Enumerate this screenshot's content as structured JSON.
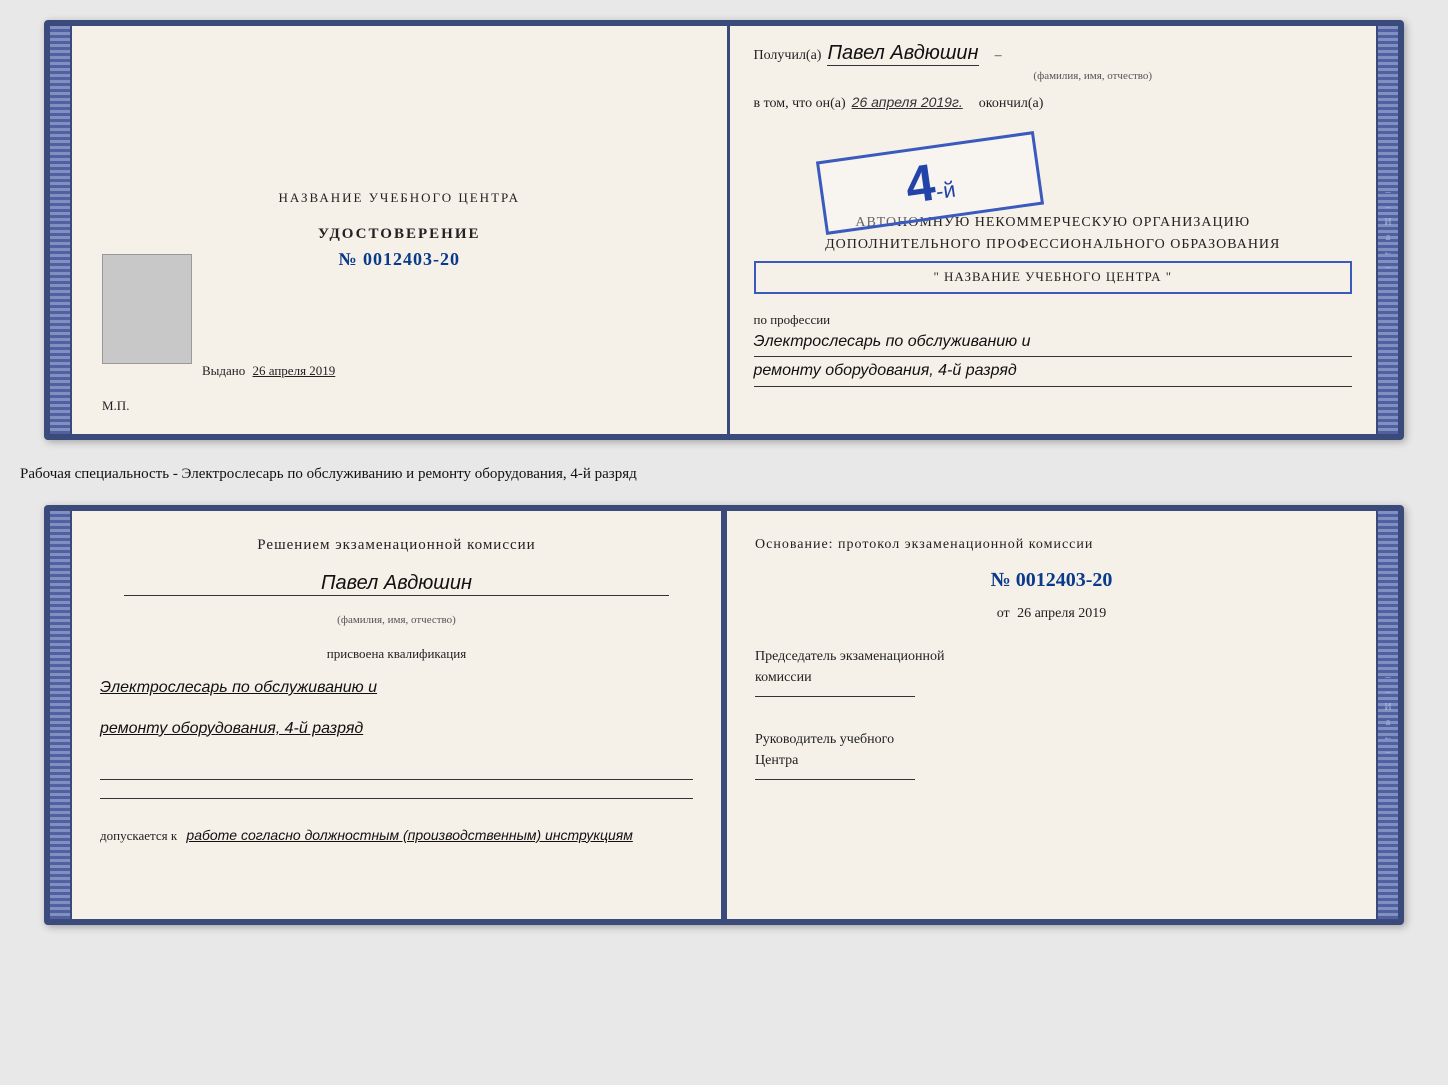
{
  "doc_top": {
    "left": {
      "center_title": "НАЗВАНИЕ УЧЕБНОГО ЦЕНТРА",
      "udostoverenie": "УДОСТОВЕРЕНИЕ",
      "number": "№ 0012403-20",
      "vydano": "Выдано",
      "vydano_date": "26 апреля 2019",
      "mp": "М.П."
    },
    "right": {
      "poluchil_prefix": "Получил(а)",
      "recipient_name": "Павел Авдюшин",
      "fio_label": "(фамилия, имя, отчество)",
      "vtom_prefix": "в том, что он(а)",
      "date": "26 апреля 2019г.",
      "okonchil": "окончил(а)",
      "rank": "4-й",
      "org_line1": "АВТОНОМНУЮ НЕКОММЕРЧЕСКУЮ ОРГАНИЗАЦИЮ",
      "org_line2": "ДОПОЛНИТЕЛЬНОГО ПРОФЕССИОНАЛЬНОГО ОБРАЗОВАНИЯ",
      "org_name": "\" НАЗВАНИЕ УЧЕБНОГО ЦЕНТРА \"",
      "po_professii": "по профессии",
      "profession_line1": "Электрослесарь по обслуживанию и",
      "profession_line2": "ремонту оборудования, 4-й разряд"
    }
  },
  "specialty_text": "Рабочая специальность - Электрослесарь по обслуживанию и ремонту оборудования, 4-й разряд",
  "doc_bottom": {
    "left": {
      "resheniye": "Решением экзаменационной комиссии",
      "name": "Павел Авдюшин",
      "fio_label": "(фамилия, имя, отчество)",
      "prisvoena": "присвоена квалификация",
      "profession_line1": "Электрослесарь по обслуживанию и",
      "profession_line2": "ремонту оборудования, 4-й разряд",
      "dopuskaetsya": "допускается к",
      "dopusk_text": "работе согласно должностным (производственным) инструкциям"
    },
    "right": {
      "osnovanie": "Основание: протокол экзаменационной комиссии",
      "number": "№ 0012403-20",
      "ot_prefix": "от",
      "date": "26 апреля 2019",
      "predsedatel_line1": "Председатель экзаменационной",
      "predsedatel_line2": "комиссии",
      "rukovoditel_line1": "Руководитель учебного",
      "rukovoditel_line2": "Центра"
    }
  },
  "spine": {
    "marks": [
      "И",
      "а",
      "←",
      "–",
      "–",
      "–",
      "–",
      "–"
    ]
  }
}
